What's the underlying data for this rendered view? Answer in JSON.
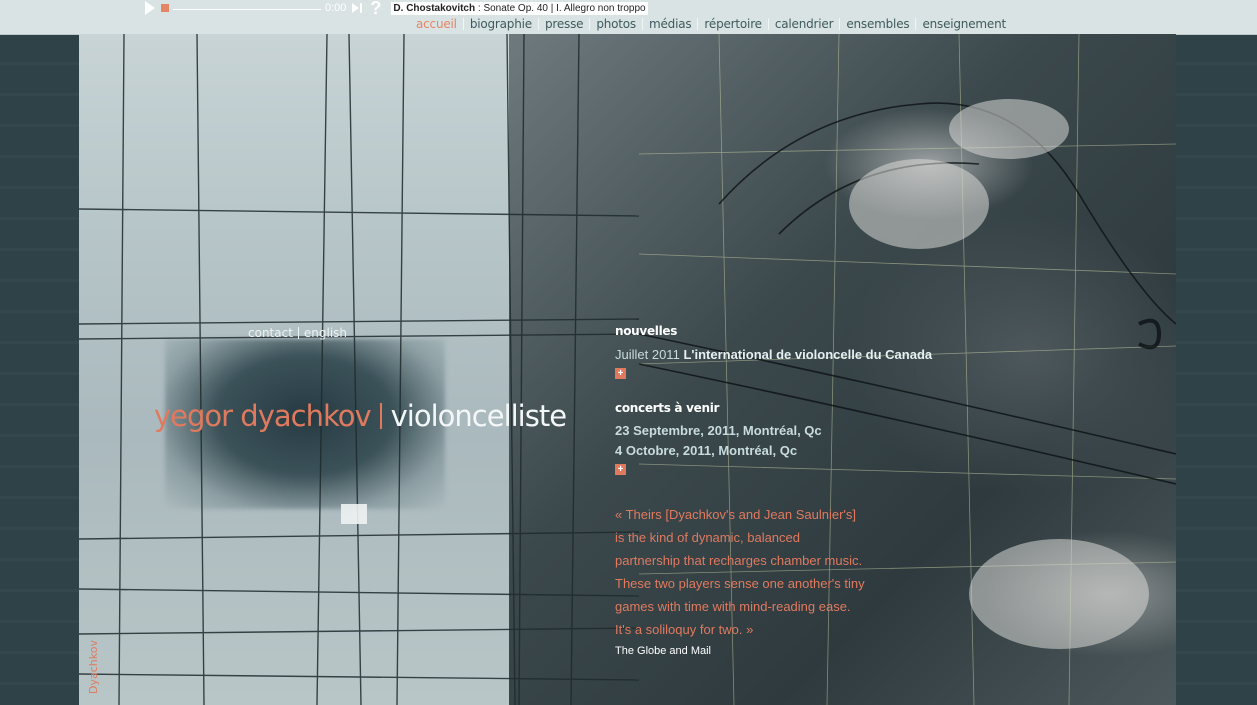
{
  "player": {
    "time": "0:00",
    "help_label": "?",
    "track_composer": "D. Chostakovitch",
    "track_title": ": Sonate Op. 40 | I. Allegro non troppo"
  },
  "nav": {
    "items": [
      {
        "label": "accueil",
        "active": true
      },
      {
        "label": "biographie"
      },
      {
        "label": "presse"
      },
      {
        "label": "photos"
      },
      {
        "label": "médias"
      },
      {
        "label": "répertoire"
      },
      {
        "label": "calendrier"
      },
      {
        "label": "ensembles"
      },
      {
        "label": "enseignement"
      }
    ]
  },
  "subnav": {
    "contact": "contact",
    "english": "english"
  },
  "artist": {
    "name": "yegor dyachkov",
    "role": "violoncelliste",
    "vertical_label": "Dyachkov"
  },
  "news": {
    "heading": "nouvelles",
    "date": "Juillet 2011",
    "title": "L'international de violoncelle du Canada",
    "more": "+"
  },
  "concerts": {
    "heading": "concerts à venir",
    "items": [
      "23 Septembre, 2011, Montréal, Qc",
      "4 Octobre, 2011, Montréal, Qc"
    ],
    "more": "+"
  },
  "quote": {
    "text": "« Theirs [Dyachkov's and Jean Saulnier's] is the kind of dynamic, balanced partnership that recharges chamber music. These two players sense one another's tiny games with time with mind-reading ease. It's a soliloquy for two. »",
    "source": "The Globe and Mail"
  },
  "colors": {
    "accent": "#e07a5f",
    "topbar": "#d9e3e3",
    "nav_text": "#3f5a5e",
    "page_bg": "#2c3e43"
  }
}
